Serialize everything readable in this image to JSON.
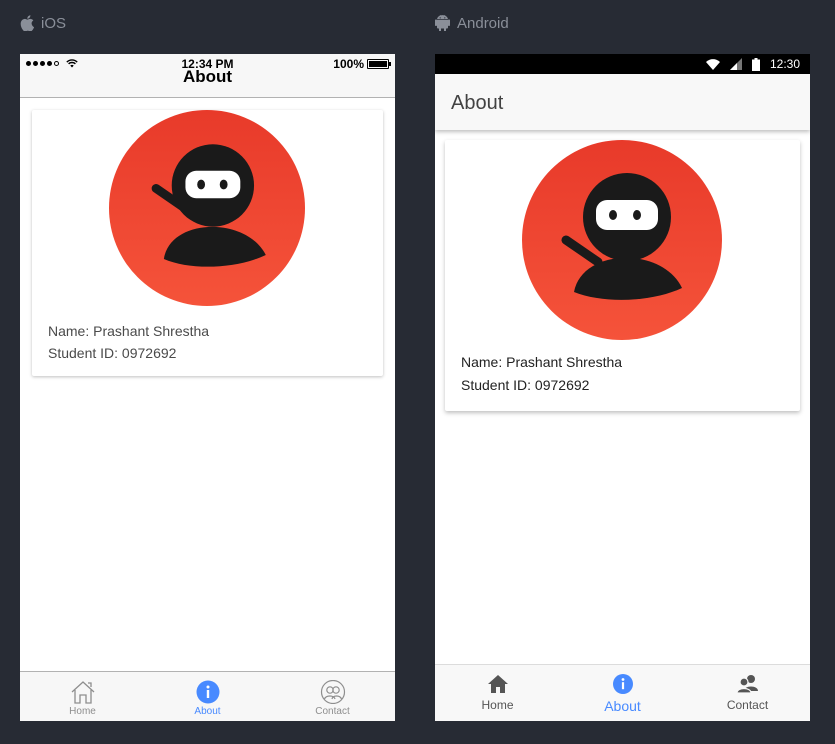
{
  "platforms": {
    "ios_label": "iOS",
    "android_label": "Android"
  },
  "ios": {
    "status_time": "12:34 PM",
    "battery": "100%",
    "title": "About",
    "name": "Name: Prashant Shrestha",
    "student_id": "Student ID: 0972692",
    "tabs": [
      {
        "label": "Home",
        "icon": "home-outline-icon"
      },
      {
        "label": "About",
        "icon": "info-icon",
        "active": true
      },
      {
        "label": "Contact",
        "icon": "contacts-outline-icon"
      }
    ]
  },
  "android": {
    "status_time": "12:30",
    "title": "About",
    "name": "Name: Prashant Shrestha",
    "student_id": "Student ID: 0972692",
    "tabs": [
      {
        "label": "Home",
        "icon": "home-icon"
      },
      {
        "label": "About",
        "icon": "info-icon",
        "active": true
      },
      {
        "label": "Contact",
        "icon": "contacts-icon"
      }
    ]
  },
  "colors": {
    "background": "#272b34",
    "accent": "#488aff",
    "avatar_red": "#ef4530",
    "ninja_black": "#1a1a1a"
  }
}
